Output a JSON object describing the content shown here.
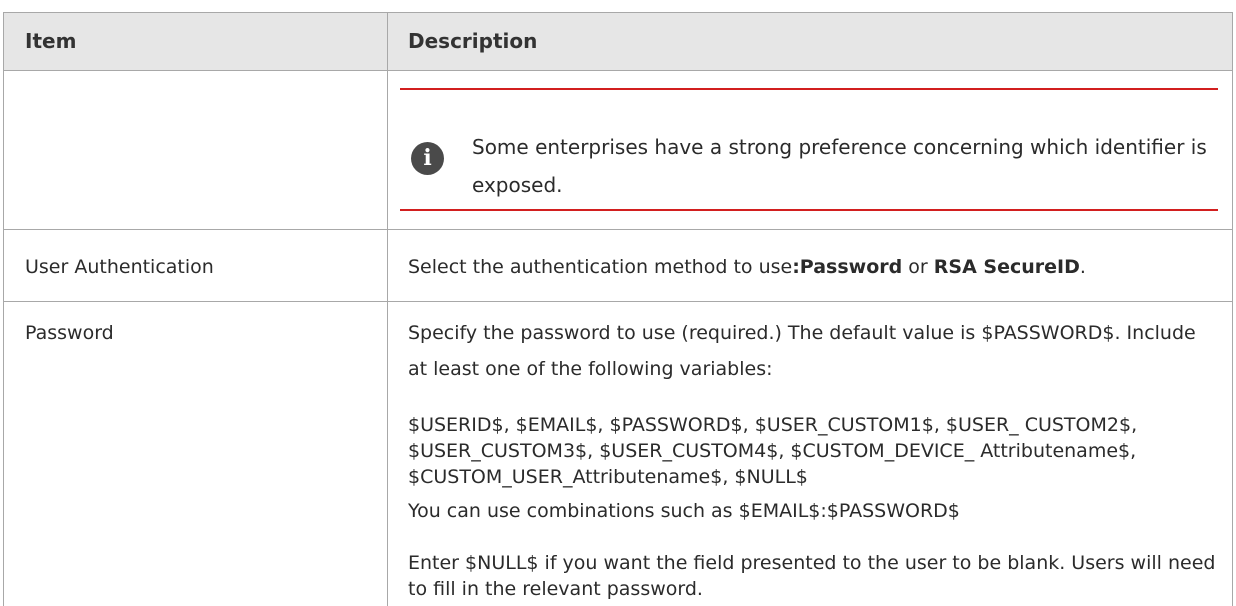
{
  "table": {
    "headers": {
      "item": "Item",
      "description": "Description"
    },
    "note": {
      "icon": "info-icon",
      "text": "Some enterprises have a strong preference concerning which identifier is exposed."
    },
    "rows": [
      {
        "item": "User Authentication",
        "description": {
          "prefix": "Select the authentication method to use",
          "option_1": ":Password",
          "connector": " or ",
          "option_2": "RSA SecureID",
          "suffix": "."
        }
      },
      {
        "item": "Password",
        "paragraphs": [
          "Specify the password to use (required.) The default value is $PASSWORD$. Include at least one of the following variables:",
          "$USERID$, $EMAIL$, $PASSWORD$, $USER_CUSTOM1$, $USER_ CUSTOM2$, $USER_CUSTOM3$, $USER_CUSTOM4$, $CUSTOM_DEVICE_ Attributename$, $CUSTOM_USER_Attributename$, $NULL$",
          "You can use combinations such as $EMAIL$:$PASSWORD$",
          "Enter $NULL$ if you want the field presented to the user to be blank. Users will need to fill in the relevant password."
        ]
      }
    ]
  },
  "colors": {
    "note_rule": "#d21f1f",
    "header_bg": "#e6e6e6",
    "border": "#a8a8a8"
  }
}
